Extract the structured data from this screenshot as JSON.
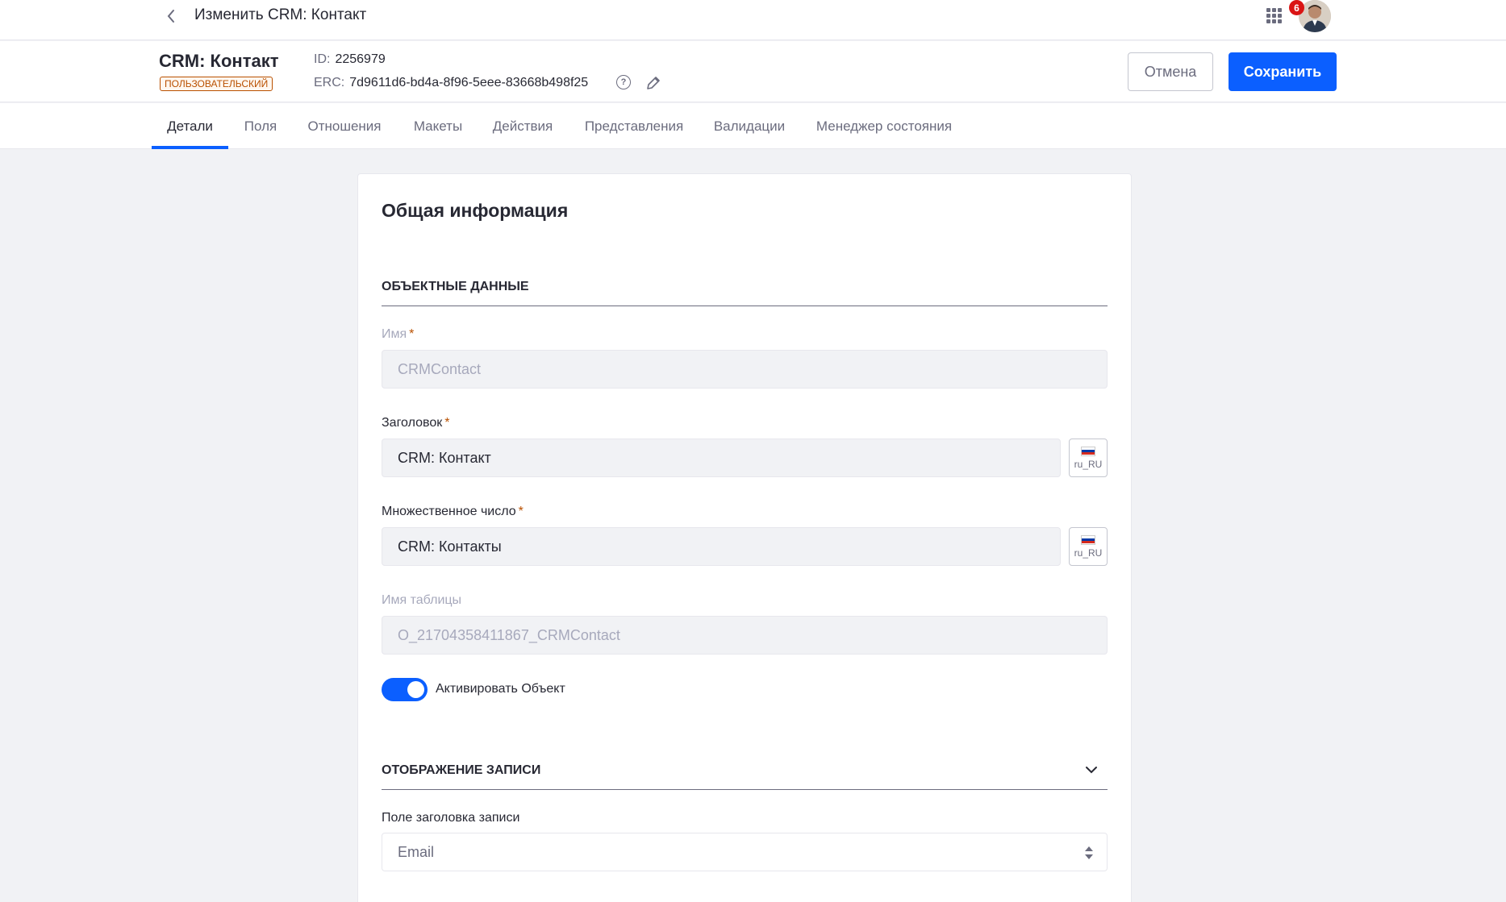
{
  "topbar": {
    "title": "Изменить CRM: Контакт",
    "notification_count": "6"
  },
  "header": {
    "object_name": "CRM: Контакт",
    "object_type": "ПОЛЬЗОВАТЕЛЬСКИЙ",
    "id_label": "ID:",
    "id_value": "2256979",
    "erc_label": "ERC:",
    "erc_value": "7d9611d6-bd4a-8f96-5eee-83668b498f25",
    "help_glyph": "?",
    "cancel_label": "Отмена",
    "save_label": "Сохранить"
  },
  "tabs": [
    {
      "label": "Детали",
      "active": true
    },
    {
      "label": "Поля"
    },
    {
      "label": "Отношения"
    },
    {
      "label": "Макеты"
    },
    {
      "label": "Действия"
    },
    {
      "label": "Представления"
    },
    {
      "label": "Валидации"
    },
    {
      "label": "Менеджер состояния"
    }
  ],
  "card": {
    "title": "Общая информация",
    "object_data": {
      "heading": "ОБЪЕКТНЫЕ ДАННЫЕ",
      "name_label": "Имя",
      "name_value": "CRMContact",
      "label_label": "Заголовок",
      "label_value": "CRM: Контакт",
      "plural_label": "Множественное число",
      "plural_value": "CRM: Контакты",
      "table_label": "Имя таблицы",
      "table_value": "O_21704358411867_CRMContact",
      "locale": "ru_RU",
      "required_mark": "*",
      "activate_label": "Активировать Объект",
      "activate_on": true
    },
    "entry_display": {
      "heading": "ОТОБРАЖЕНИЕ ЗАПИСИ",
      "title_field_label": "Поле заголовка записи",
      "title_field_value": "Email"
    }
  },
  "colors": {
    "primary": "#0b5fff",
    "custom_badge": "#b95000",
    "notification": "#da1414"
  }
}
